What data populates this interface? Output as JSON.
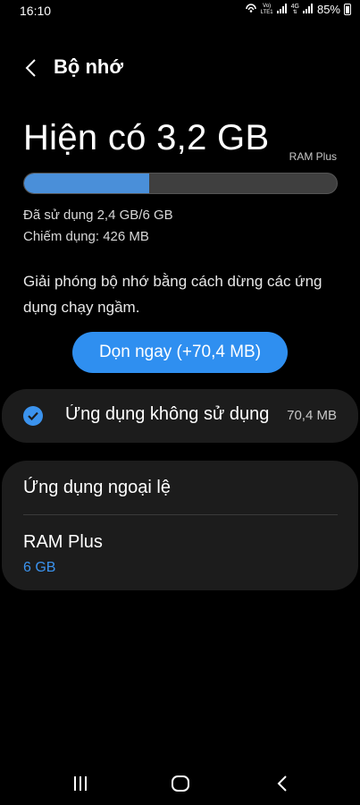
{
  "status_bar": {
    "time": "16:10",
    "network_tag_top": "Vo)",
    "network_tag_bottom": "LTE1",
    "network_4g": "4G",
    "battery": "85%"
  },
  "header": {
    "back_icon": "chevron-left-icon",
    "title": "Bộ nhớ"
  },
  "memory": {
    "available": "Hiện có 3,2 GB",
    "ram_plus_tag": "RAM Plus",
    "used_fraction": 0.4,
    "used_text": "Đã sử dụng 2,4 GB/6 GB",
    "occupied_text": "Chiếm dụng: 426 MB",
    "description": "Giải phóng bộ nhớ bằng cách dừng các ứng dụng chạy ngầm.",
    "clean_button": "Dọn ngay (+70,4 MB)"
  },
  "unused_apps": {
    "checked": true,
    "label": "Ứng dụng không sử dụng",
    "size": "70,4 MB"
  },
  "settings": {
    "exception_apps": "Ứng dụng ngoại lệ",
    "ram_plus_label": "RAM Plus",
    "ram_plus_value": "6 GB"
  },
  "colors": {
    "accent": "#2f8ff0",
    "bar_fill": "#4a8fd9",
    "bar_track": "#3f3f3f",
    "card": "#1c1c1c",
    "background": "#000000"
  },
  "nav": {
    "recents_icon": "recents-icon",
    "home_icon": "home-icon",
    "back_icon": "back-icon"
  }
}
